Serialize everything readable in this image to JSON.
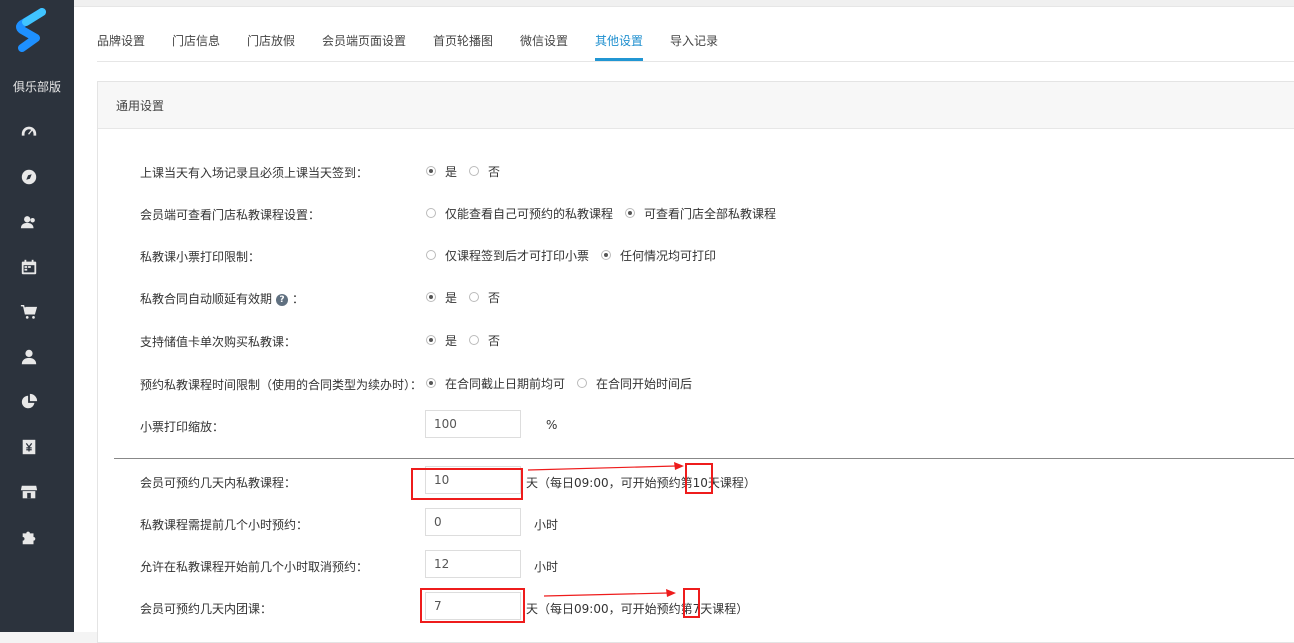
{
  "sidebar": {
    "club_label": "俱乐部版",
    "icons": [
      "dashboard-gauge-icon",
      "compass-icon",
      "members-icon",
      "calendar-icon",
      "cart-icon",
      "user-icon",
      "pie-chart-icon",
      "finance-yen-icon",
      "store-icon",
      "puzzle-icon"
    ]
  },
  "tabs": [
    {
      "label": "品牌设置"
    },
    {
      "label": "门店信息"
    },
    {
      "label": "门店放假"
    },
    {
      "label": "会员端页面设置"
    },
    {
      "label": "首页轮播图"
    },
    {
      "label": "微信设置"
    },
    {
      "label": "其他设置",
      "active": true
    },
    {
      "label": "导入记录"
    }
  ],
  "panel": {
    "title": "通用设置"
  },
  "settings": {
    "r1": {
      "label": "上课当天有入场记录且必须上课当天签到：",
      "opt1": "是",
      "opt2": "否"
    },
    "r2": {
      "label": "会员端可查看门店私教课程设置：",
      "opt1": "仅能查看自己可预约的私教课程",
      "opt2": "可查看门店全部私教课程"
    },
    "r3": {
      "label": "私教课小票打印限制：",
      "opt1": "仅课程签到后才可打印小票",
      "opt2": "任何情况均可打印"
    },
    "r4": {
      "label": "私教合同自动顺延有效期",
      "label_suffix": "：",
      "help": "?",
      "opt1": "是",
      "opt2": "否"
    },
    "r5": {
      "label": "支持储值卡单次购买私教课：",
      "opt1": "是",
      "opt2": "否"
    },
    "r6": {
      "label": "预约私教课程时间限制（使用的合同类型为续办时）：",
      "opt1": "在合同截止日期前均可",
      "opt2": "在合同开始时间后"
    },
    "r7": {
      "label": "小票打印缩放：",
      "value": "100",
      "unit": "%"
    },
    "r8": {
      "label": "会员可预约几天内私教课程：",
      "value": "10",
      "unit": "天（每日09:00，可开始预约第10天课程）"
    },
    "r9": {
      "label": "私教课程需提前几个小时预约：",
      "value": "0",
      "unit": "小时"
    },
    "r10": {
      "label": "允许在私教课程开始前几个小时取消预约：",
      "value": "12",
      "unit": "小时"
    },
    "r11": {
      "label": "会员可预约几天内团课：",
      "value": "7",
      "unit": "天（每日09:00，可开始预约第7天课程）"
    }
  },
  "annotation_color": "#ee1c1c"
}
